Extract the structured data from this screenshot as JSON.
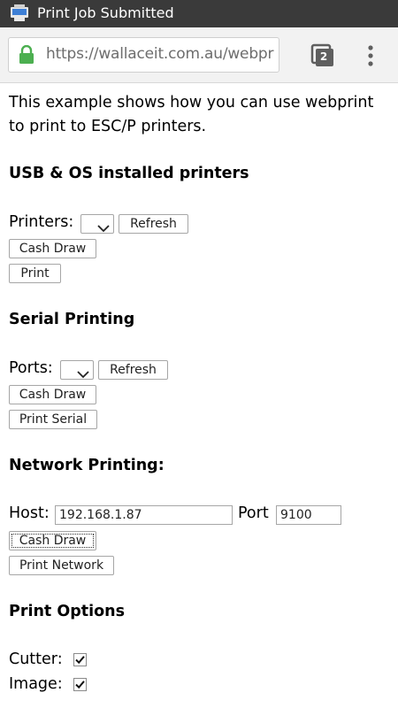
{
  "status_bar": {
    "title": "Print Job Submitted",
    "icon": "printer-notification-icon"
  },
  "browser": {
    "url": "https://wallaceit.com.au/webpr",
    "tab_count": "2"
  },
  "intro": "This example shows how you can use webprint to print to ESC/P printers.",
  "usb_section": {
    "heading": "USB & OS installed printers",
    "printers_label": "Printers:",
    "refresh_label": "Refresh",
    "cash_draw_label": "Cash Draw",
    "print_label": "Print"
  },
  "serial_section": {
    "heading": "Serial Printing",
    "ports_label": "Ports:",
    "refresh_label": "Refresh",
    "cash_draw_label": "Cash Draw",
    "print_label": "Print Serial"
  },
  "network_section": {
    "heading": "Network Printing:",
    "host_label": "Host:",
    "host_value": "192.168.1.87",
    "port_label": "Port",
    "port_value": "9100",
    "cash_draw_label": "Cash Draw",
    "print_label": "Print Network"
  },
  "options_section": {
    "heading": "Print Options",
    "cutter_label": "Cutter:",
    "cutter_checked": true,
    "image_label": "Image:",
    "image_checked": true
  },
  "colors": {
    "status_bar": "#3a3a3a",
    "toolbar": "#f2f2f2",
    "lock_green": "#4caf50"
  }
}
